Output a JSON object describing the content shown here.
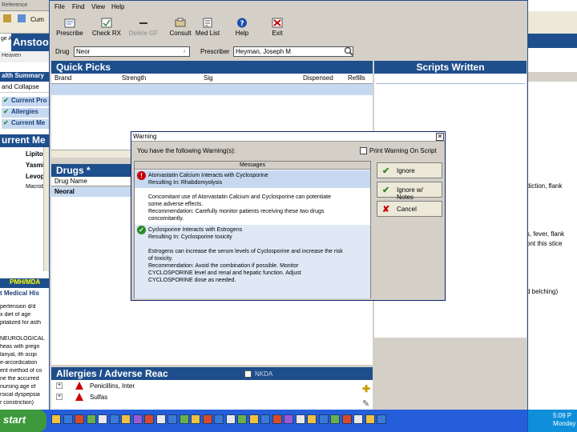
{
  "background_app": {
    "menu_fragment": "Reference",
    "toolbar_fragment": "Cum",
    "patient_name_fragment": "Anstoo",
    "gender_age_fragment": "ge A",
    "note_fragment": "Heaven",
    "health_summary": "alth Summary",
    "expand_collapse": "and  Collapse",
    "summary_rows": [
      "Current Pro",
      "Allergies",
      "Current Me"
    ],
    "current_meds_header": "urrent Me",
    "meds": [
      "Lipitor",
      "Yasmin",
      "Levop",
      "Macrob"
    ],
    "pmh_header": "PMH/MDA",
    "pmh_title": "t Medical His",
    "pmh_lines": [
      "pertension d/d",
      "x  diet of age",
      "pitalized for asth",
      "",
      "NEUROLOGICAL",
      "heas with pregn",
      "lanyal, ith ocipi",
      "e-arcordication",
      "ent method of co",
      "ne the accurred",
      "nursing age of",
      "rsical dyspepsia",
      "r constriction)"
    ],
    "right_lines": [
      "diction, flank",
      "s, fever, flank",
      "ont this stice",
      "d belching)"
    ]
  },
  "window": {
    "menus": [
      "File",
      "Find",
      "View",
      "Help"
    ],
    "toolbar": [
      {
        "label": "Prescribe",
        "icon": "prescribe-icon",
        "disabled": false
      },
      {
        "label": "Check RX",
        "icon": "check-rx-icon",
        "disabled": false
      },
      {
        "label": "Delete GF",
        "icon": "delete-icon",
        "disabled": true
      },
      {
        "label": "Consult",
        "icon": "consult-icon",
        "disabled": false
      },
      {
        "label": "Med List",
        "icon": "med-list-icon",
        "disabled": false
      },
      {
        "label": "Help",
        "icon": "help-icon",
        "disabled": false
      },
      {
        "label": "Exit",
        "icon": "exit-icon",
        "disabled": false
      }
    ],
    "drug_label": "Drug",
    "drug_value": "Neor",
    "prescriber_label": "Prescriber",
    "prescriber_value": "Heyman, Joseph M",
    "quick_picks_title": "Quick Picks",
    "quick_picks_columns": [
      "Brand",
      "Strength",
      "Sig",
      "Dispensed",
      "Refills"
    ],
    "scripts_written_title": "Scripts Written",
    "drugs_title": "Drugs *",
    "drugs_column": "Drug Name",
    "drugs_selected": "Neoral",
    "allergies_title": "Allergies / Adverse Reac",
    "nkda_label": "NKDA",
    "allergies": [
      "Penicillins, Inter",
      "Sulfas"
    ]
  },
  "dialog": {
    "title": "Warning",
    "message": "You have the following Warning(s):",
    "print_checkbox_label": "Print Warning On Script",
    "list_header": "Messages",
    "warnings": [
      {
        "severity": "severe",
        "color": "#cc0000",
        "lines": [
          "Atorvastatin Calcium Interacts with Cyclosporine",
          "Resulting In: Rhabdomyolysis",
          "",
          "Concomitant use of Atorvastatin Calcium and Cyclosporine can potentiate",
          "some adverse effects.",
          "Recommendation: Carefully monitor patients receiving these two drugs",
          "concomitantly."
        ]
      },
      {
        "severity": "moderate",
        "color": "#2a8a2a",
        "lines": [
          "Cyclosporine Interacts with Estrogens",
          "Resulting In: Cyclosporine toxicity",
          "",
          "Estrogens can increase the serum levels of Cyclosporine and increase the risk",
          "of toxicity.",
          "Recommendation: Avoid the combination if possible. Monitor",
          "CYCLOSPORINE level and renal and hepatic function. Adjust",
          "CYCLOSPORINE dose as needed."
        ]
      }
    ],
    "buttons": {
      "ignore": "Ignore",
      "ignore_notes": "Ignore w/ Notes",
      "cancel": "Cancel"
    }
  },
  "taskbar": {
    "start_label": "start",
    "clock_time": "5:09 P",
    "clock_day": "Monday"
  }
}
